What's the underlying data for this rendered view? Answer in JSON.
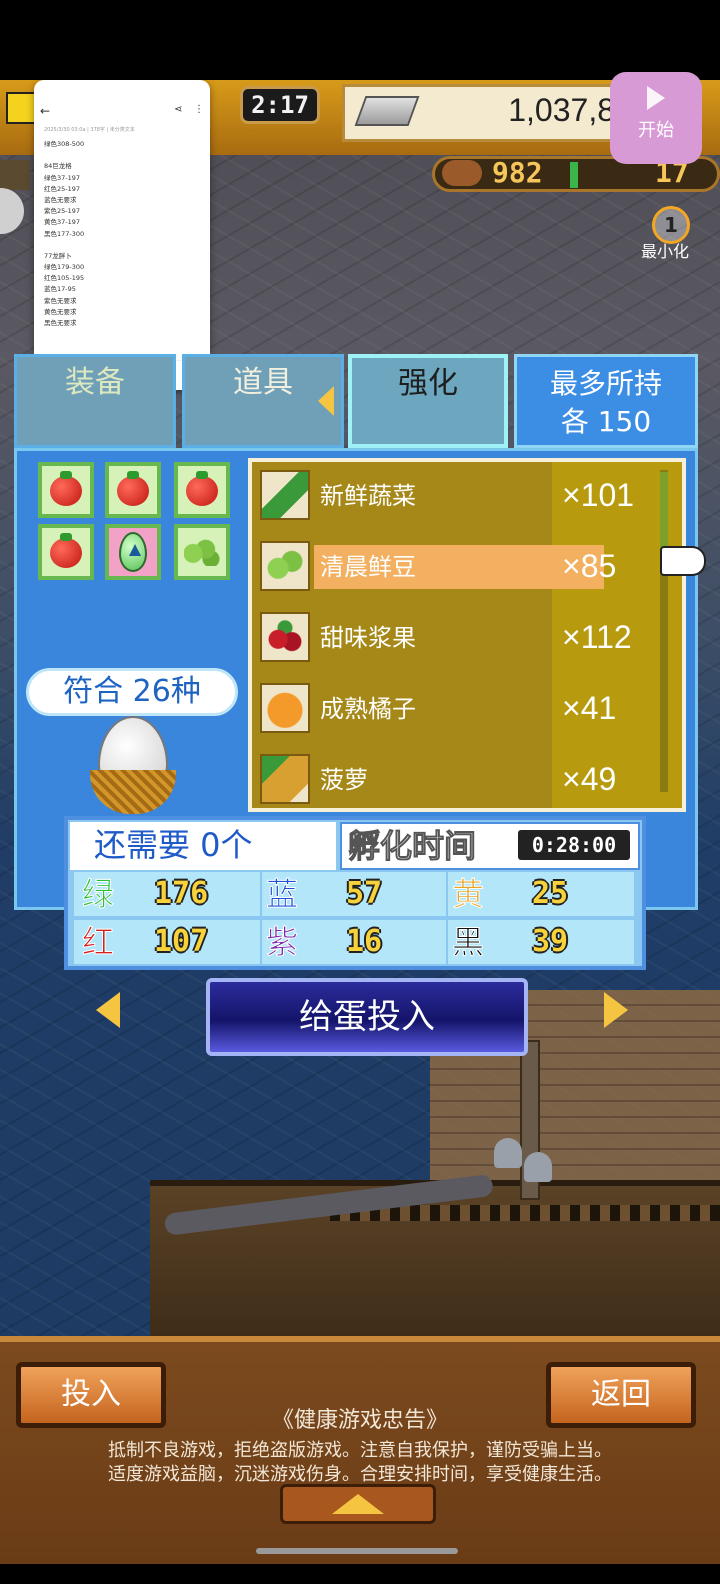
{
  "hud": {
    "time": "2:17",
    "money": "1,037,8",
    "food": "982",
    "count": "17"
  },
  "recorder": {
    "start_label": "开始",
    "minimize_label": "最小化",
    "badge": "1"
  },
  "notes": {
    "meta": "2025/3/30 03:0a | 378字 | 未分类文本",
    "lines": [
      "绿色308-500",
      "",
      "84巨龙格",
      "绿色37-197",
      "红色25-197",
      "蓝色无要求",
      "紫色25-197",
      "黄色37-197",
      "黑色177-300",
      "",
      "77龙胖卜",
      "绿色179-300",
      "红色105-195",
      "蓝色17-95",
      "紫色无要求",
      "黄色无要求",
      "黑色无要求"
    ]
  },
  "tabs": {
    "equip": "装备",
    "items": "道具",
    "enhance": "强化",
    "max_line1": "最多所持",
    "max_line2": "各 150"
  },
  "match_label": "符合 26种",
  "items": [
    {
      "name": "新鲜蔬菜",
      "qty": "×101"
    },
    {
      "name": "清晨鲜豆",
      "qty": "×85"
    },
    {
      "name": "甜味浆果",
      "qty": "×112"
    },
    {
      "name": "成熟橘子",
      "qty": "×41"
    },
    {
      "name": "菠萝",
      "qty": "×49"
    }
  ],
  "selected_item_index": 1,
  "need_label": "还需要 0个",
  "hatch_label": "孵化时间",
  "hatch_time": "0:28:00",
  "stats": [
    {
      "label": "绿",
      "value": "176",
      "color": "#2fbe3a"
    },
    {
      "label": "蓝",
      "value": "57",
      "color": "#1f4fd6"
    },
    {
      "label": "黄",
      "value": "25",
      "color": "#e7a52a"
    },
    {
      "label": "红",
      "value": "107",
      "color": "#d61f1f"
    },
    {
      "label": "紫",
      "value": "16",
      "color": "#7a2aa8"
    },
    {
      "label": "黑",
      "value": "39",
      "color": "#111111"
    }
  ],
  "feed_button": "给蛋投入",
  "bottom": {
    "insert": "投入",
    "back": "返回",
    "health_title": "《健康游戏忠告》",
    "health_line1": "抵制不良游戏，拒绝盗版游戏。注意自我保护，谨防受骗上当。",
    "health_line2": "适度游戏益脑，沉迷游戏伤身。合理安排时间，享受健康生活。"
  },
  "colors": {
    "panel_blue": "#3a86dc",
    "list_gold": "#b89a0e",
    "highlight": "#f2b060"
  }
}
